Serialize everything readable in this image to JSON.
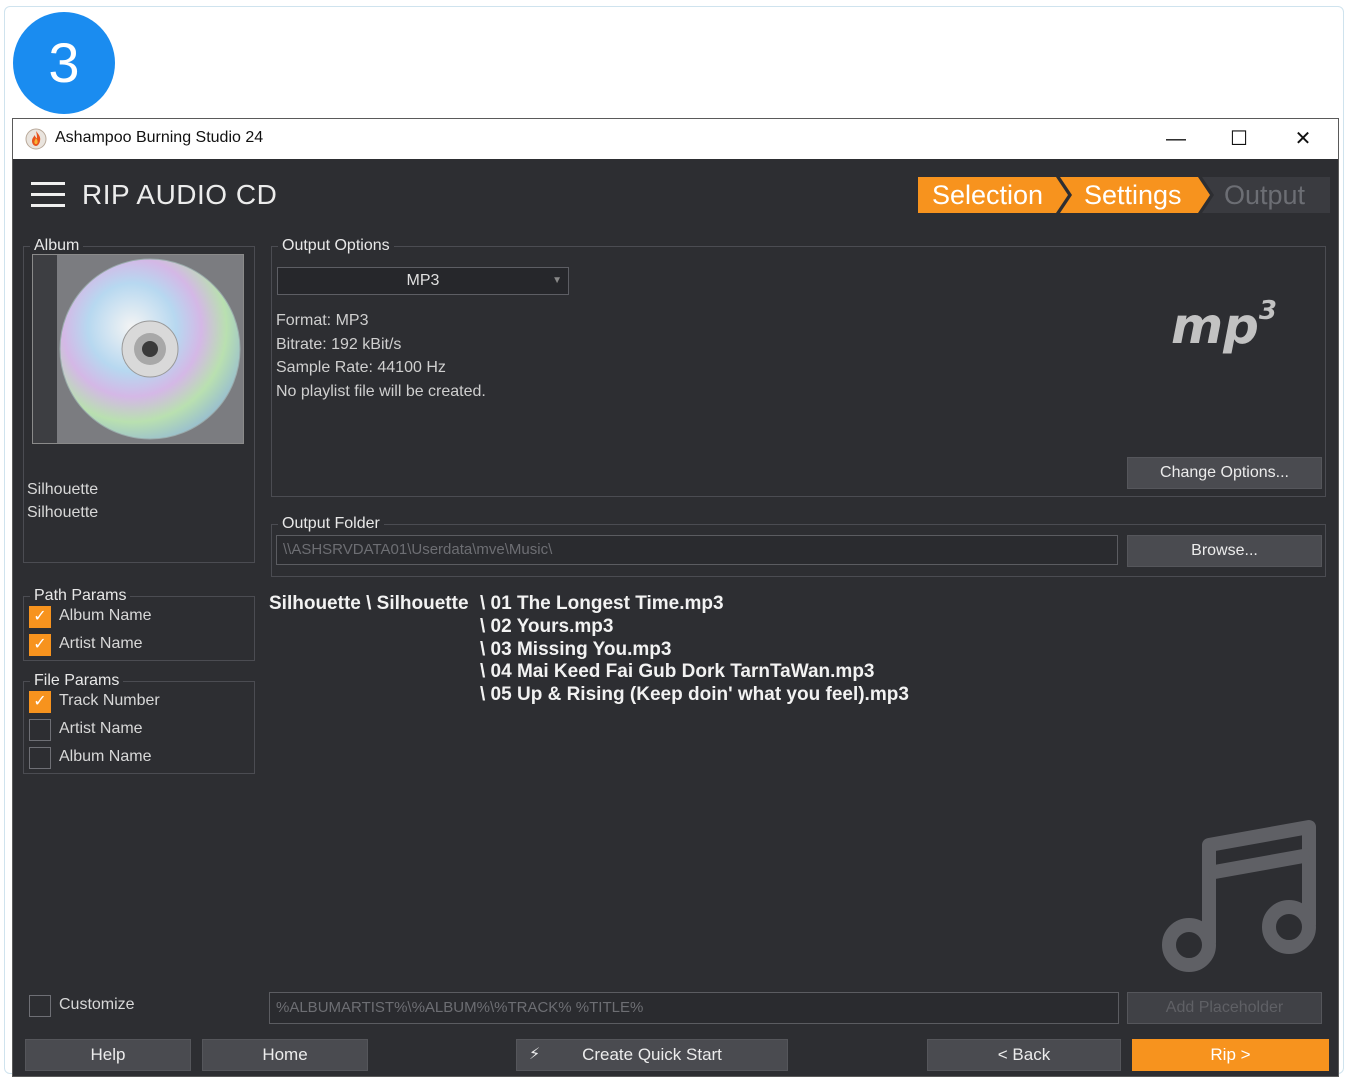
{
  "step_badge": "3",
  "window": {
    "title": "Ashampoo Burning Studio 24",
    "min_glyph": "—",
    "max_glyph": "☐",
    "close_glyph": "✕"
  },
  "header": {
    "title": "RIP AUDIO CD",
    "steps": [
      "Selection",
      "Settings",
      "Output"
    ]
  },
  "album": {
    "legend": "Album",
    "artist": "Silhouette",
    "name": "Silhouette"
  },
  "path_params": {
    "legend": "Path Params",
    "items": [
      {
        "label": "Album Name",
        "checked": true
      },
      {
        "label": "Artist Name",
        "checked": true
      }
    ]
  },
  "file_params": {
    "legend": "File Params",
    "items": [
      {
        "label": "Track Number",
        "checked": true
      },
      {
        "label": "Artist Name",
        "checked": false
      },
      {
        "label": "Album Name",
        "checked": false
      }
    ]
  },
  "output_options": {
    "legend": "Output Options",
    "selected_format": "MP3",
    "details": [
      "Format: MP3",
      "Bitrate: 192 kBit/s",
      "Sample Rate: 44100 Hz",
      "No playlist file will be created."
    ],
    "logo_text": "mp",
    "logo_sup": "3",
    "change_button": "Change Options..."
  },
  "output_folder": {
    "legend": "Output Folder",
    "path": "\\\\ASHSRVDATA01\\Userdata\\mve\\Music\\",
    "browse_button": "Browse..."
  },
  "preview": {
    "prefix": "Silhouette \\ Silhouette",
    "files": [
      "\\ 01 The Longest Time.mp3",
      "\\ 02 Yours.mp3",
      "\\ 03 Missing You.mp3",
      "\\ 04 Mai Keed Fai Gub Dork TarnTaWan.mp3",
      "\\ 05 Up & Rising (Keep doin' what you feel).mp3"
    ]
  },
  "customize": {
    "label": "Customize",
    "checked": false,
    "pattern": "%ALBUMARTIST%\\%ALBUM%\\%TRACK% %TITLE%",
    "add_placeholder_button": "Add Placeholder"
  },
  "footer": {
    "help": "Help",
    "home": "Home",
    "quick_start": "Create Quick Start",
    "back": "< Back",
    "rip": "Rip >"
  },
  "colors": {
    "accent": "#f7931e",
    "badge": "#1a8cf0",
    "background": "#2d2e32"
  }
}
